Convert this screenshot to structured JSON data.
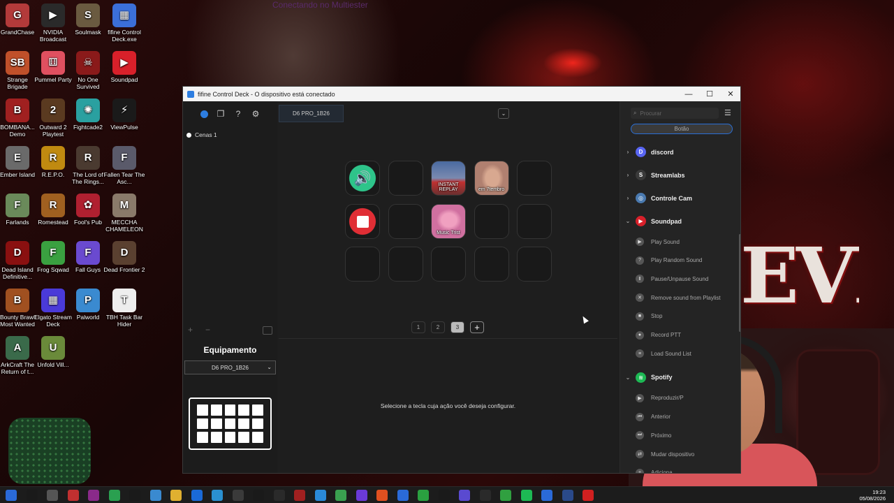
{
  "wallpaper": {
    "overlay_text": "Conectando no Multiester",
    "evil_text": "EVIL"
  },
  "desktop_icons": [
    {
      "label": "GrandChase",
      "color": "#b33a3a",
      "glyph": "G"
    },
    {
      "label": "NVIDIA Broadcast",
      "color": "#2a2a2a",
      "glyph": "▶"
    },
    {
      "label": "Soulmask",
      "color": "#6a5a40",
      "glyph": "S"
    },
    {
      "label": "fifine Control Deck.exe",
      "color": "#3b6fd8",
      "glyph": "▦"
    },
    {
      "label": "Strange Brigade",
      "color": "#c0502a",
      "glyph": "SB"
    },
    {
      "label": "Pummel Party",
      "color": "#e05060",
      "glyph": "⚅"
    },
    {
      "label": "No One Survived",
      "color": "#8a1a1a",
      "glyph": "☠"
    },
    {
      "label": "Soundpad",
      "color": "#d8202a",
      "glyph": "▶"
    },
    {
      "label": "BOMBANA... Demo",
      "color": "#a02020",
      "glyph": "B"
    },
    {
      "label": "Outward 2 Playtest",
      "color": "#5a3a20",
      "glyph": "2"
    },
    {
      "label": "Fightcade2",
      "color": "#2aa0a0",
      "glyph": "✺"
    },
    {
      "label": "ViewPulse",
      "color": "#1a1a1a",
      "glyph": "⚡"
    },
    {
      "label": "Ember Island",
      "color": "#6a6a6a",
      "glyph": "E"
    },
    {
      "label": "R.E.P.O.",
      "color": "#c08a10",
      "glyph": "R"
    },
    {
      "label": "The Lord of The Rings...",
      "color": "#4a3a30",
      "glyph": "R"
    },
    {
      "label": "Fallen Tear The Asc...",
      "color": "#5a5a6a",
      "glyph": "F"
    },
    {
      "label": "Farlands",
      "color": "#6a8a5a",
      "glyph": "F"
    },
    {
      "label": "Romestead",
      "color": "#a06020",
      "glyph": "R"
    },
    {
      "label": "Fool's Pub",
      "color": "#b02030",
      "glyph": "✿"
    },
    {
      "label": "MECCHA CHAMELEON",
      "color": "#8a7a6a",
      "glyph": "M"
    },
    {
      "label": "Dead Island Definitive...",
      "color": "#8a1010",
      "glyph": "D"
    },
    {
      "label": "Frog Sqwad",
      "color": "#3aa040",
      "glyph": "F"
    },
    {
      "label": "Fall Guys",
      "color": "#6a4ad0",
      "glyph": "F"
    },
    {
      "label": "Dead Frontier 2",
      "color": "#5a4030",
      "glyph": "D"
    },
    {
      "label": "Bounty Brawl Most Wanted",
      "color": "#a05020",
      "glyph": "B"
    },
    {
      "label": "Elgato Stream Deck",
      "color": "#4a3ad8",
      "glyph": "▦"
    },
    {
      "label": "Palworld",
      "color": "#3a8ad0",
      "glyph": "P"
    },
    {
      "label": "TBH Task Bar Hider",
      "color": "#eeeeee",
      "glyph": "T"
    },
    {
      "label": "ArkCraft The Return of t...",
      "color": "#3a6a4a",
      "glyph": "A"
    },
    {
      "label": "Unfold Vill...",
      "color": "#6a8a3a",
      "glyph": "U"
    }
  ],
  "window": {
    "title": "fifine Control Deck - O dispositivo está conectado",
    "device_tab": "D6 PRO_1B26",
    "scene_label": "Cenas 1",
    "keys": [
      {
        "label": "",
        "style": "sound"
      },
      {
        "label": "",
        "style": "empty"
      },
      {
        "label": "INSTANT REPLAY",
        "style": "replay"
      },
      {
        "label": "em 7tembro",
        "style": "face"
      },
      {
        "label": "",
        "style": "empty"
      },
      {
        "label": "",
        "style": "stop"
      },
      {
        "label": "",
        "style": "empty"
      },
      {
        "label": "Music Trist",
        "style": "music"
      },
      {
        "label": "",
        "style": "empty"
      },
      {
        "label": "",
        "style": "empty"
      },
      {
        "label": "",
        "style": "empty"
      },
      {
        "label": "",
        "style": "empty"
      },
      {
        "label": "",
        "style": "empty"
      },
      {
        "label": "",
        "style": "empty"
      },
      {
        "label": "",
        "style": "empty"
      }
    ],
    "pages": [
      "1",
      "2",
      "3",
      "+"
    ],
    "active_page": "3",
    "hint": "Selecione a tecla cuja ação você deseja configurar.",
    "equip_title": "Equipamento",
    "equip_device": "D6 PRO_1B26",
    "search_placeholder": "Procurar",
    "tab_label": "Botão",
    "plugins": [
      {
        "name": "discord",
        "color": "#5865f2",
        "glyph": "D"
      },
      {
        "name": "Streamlabs",
        "color": "#3a3a3a",
        "glyph": "S"
      },
      {
        "name": "Controle Cam",
        "color": "#4a7ab0",
        "glyph": "◎"
      },
      {
        "name": "Soundpad",
        "color": "#d8202a",
        "glyph": "▶"
      }
    ],
    "soundpad_actions": [
      {
        "label": "Play Sound",
        "glyph": "▶"
      },
      {
        "label": "Play Random Sound",
        "glyph": "?"
      },
      {
        "label": "Pause/Unpause Sound",
        "glyph": "Ⅱ"
      },
      {
        "label": "Remove sound from Playlist",
        "glyph": "✕"
      },
      {
        "label": "Stop",
        "glyph": "■"
      },
      {
        "label": "Record PTT",
        "glyph": "●"
      },
      {
        "label": "Load Sound List",
        "glyph": "≡"
      }
    ],
    "spotify": {
      "name": "Spotify",
      "color": "#1db954",
      "glyph": "≋"
    },
    "spotify_actions": [
      {
        "label": "Reproduzir/P",
        "glyph": "▶"
      },
      {
        "label": "Anterior",
        "glyph": "⏮"
      },
      {
        "label": "Próximo",
        "glyph": "⏭"
      },
      {
        "label": "Mudar dispositivo",
        "glyph": "⇄"
      },
      {
        "label": "Adiciona",
        "glyph": "+"
      }
    ]
  },
  "clock": {
    "time": "19:23",
    "date": "05/08/2026"
  }
}
